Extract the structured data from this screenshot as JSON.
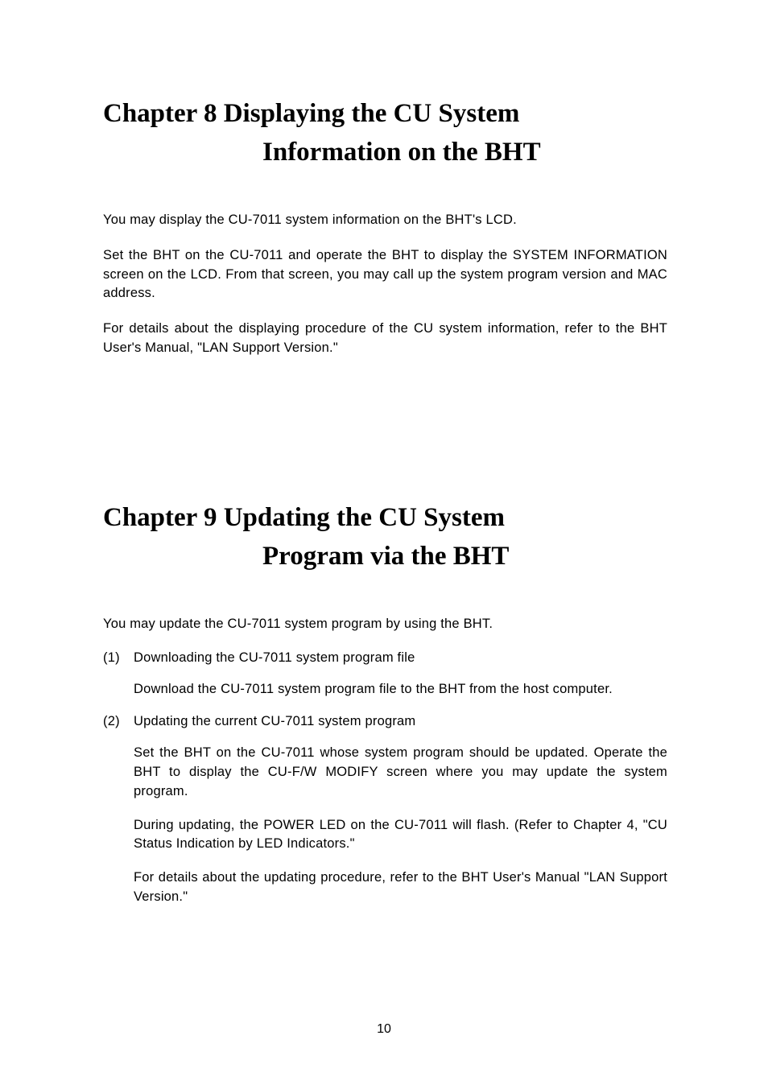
{
  "chapter8": {
    "title_line1": "Chapter 8   Displaying the CU System",
    "title_line2": "Information on the BHT",
    "para1": "You may display the CU-7011 system information on the BHT's LCD.",
    "para2": "Set the BHT on the CU-7011 and operate the BHT to display the SYSTEM INFORMATION screen on the LCD. From that screen, you may call up the system program version and MAC address.",
    "para3": "For details about the displaying procedure of the CU system information, refer to the BHT User's Manual, \"LAN Support Version.\""
  },
  "chapter9": {
    "title_line1": "Chapter 9   Updating the CU System",
    "title_line2": "Program via the BHT",
    "intro": "You may update the CU-7011 system program by using the BHT.",
    "item1": {
      "num": "(1)",
      "title": "Downloading the CU-7011 system program file",
      "body1": "Download the CU-7011 system program file to the BHT from the host computer."
    },
    "item2": {
      "num": "(2)",
      "title": "Updating the current CU-7011 system program",
      "body1": "Set the BHT on the CU-7011 whose system program should be updated. Operate the BHT to display the CU-F/W MODIFY screen where you may update the system program.",
      "body2": "During updating, the POWER LED on the CU-7011 will flash. (Refer to Chapter 4, \"CU Status Indication by LED Indicators.\"",
      "body3": "For details about the updating procedure, refer to the BHT User's Manual \"LAN Support Version.\""
    }
  },
  "page_number": "10"
}
